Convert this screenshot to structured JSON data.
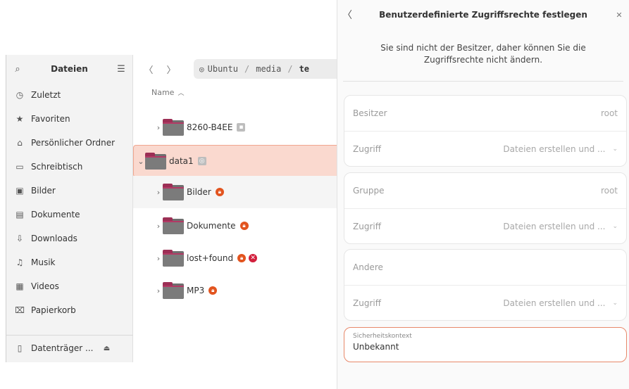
{
  "sidebar": {
    "title": "Dateien",
    "items": [
      {
        "label": "Zuletzt",
        "icon": "clock-icon"
      },
      {
        "label": "Favoriten",
        "icon": "star-icon"
      },
      {
        "label": "Persönlicher Ordner",
        "icon": "home-icon"
      },
      {
        "label": "Schreibtisch",
        "icon": "desktop-icon"
      },
      {
        "label": "Bilder",
        "icon": "image-icon"
      },
      {
        "label": "Dokumente",
        "icon": "document-icon"
      },
      {
        "label": "Downloads",
        "icon": "download-icon"
      },
      {
        "label": "Musik",
        "icon": "music-icon"
      },
      {
        "label": "Videos",
        "icon": "video-icon"
      },
      {
        "label": "Papierkorb",
        "icon": "trash-icon"
      }
    ],
    "drive": {
      "label": "Datenträger ...",
      "icon": "drive-icon"
    }
  },
  "path": {
    "root": "Ubuntu",
    "p1": "media",
    "p2": "te"
  },
  "list": {
    "col_name": "Name",
    "rows": [
      {
        "name": "8260-B4EE"
      },
      {
        "name": "data1"
      },
      {
        "name": "Bilder"
      },
      {
        "name": "Dokumente"
      },
      {
        "name": "lost+found"
      },
      {
        "name": "MP3"
      }
    ]
  },
  "dialog": {
    "title": "Benutzerdefinierte Zugriffsrechte festlegen",
    "note": "Sie sind nicht der Besitzer, daher können Sie die Zugriffsrechte nicht ändern.",
    "owner_label": "Besitzer",
    "owner_value": "root",
    "group_label": "Gruppe",
    "group_value": "root",
    "other_label": "Andere",
    "access_label": "Zugriff",
    "access_value": "Dateien erstellen und ...",
    "context_label": "Sicherheitskontext",
    "context_value": "Unbekannt"
  },
  "colors": {
    "accent": "#e95420",
    "selection": "#fad9cf"
  }
}
